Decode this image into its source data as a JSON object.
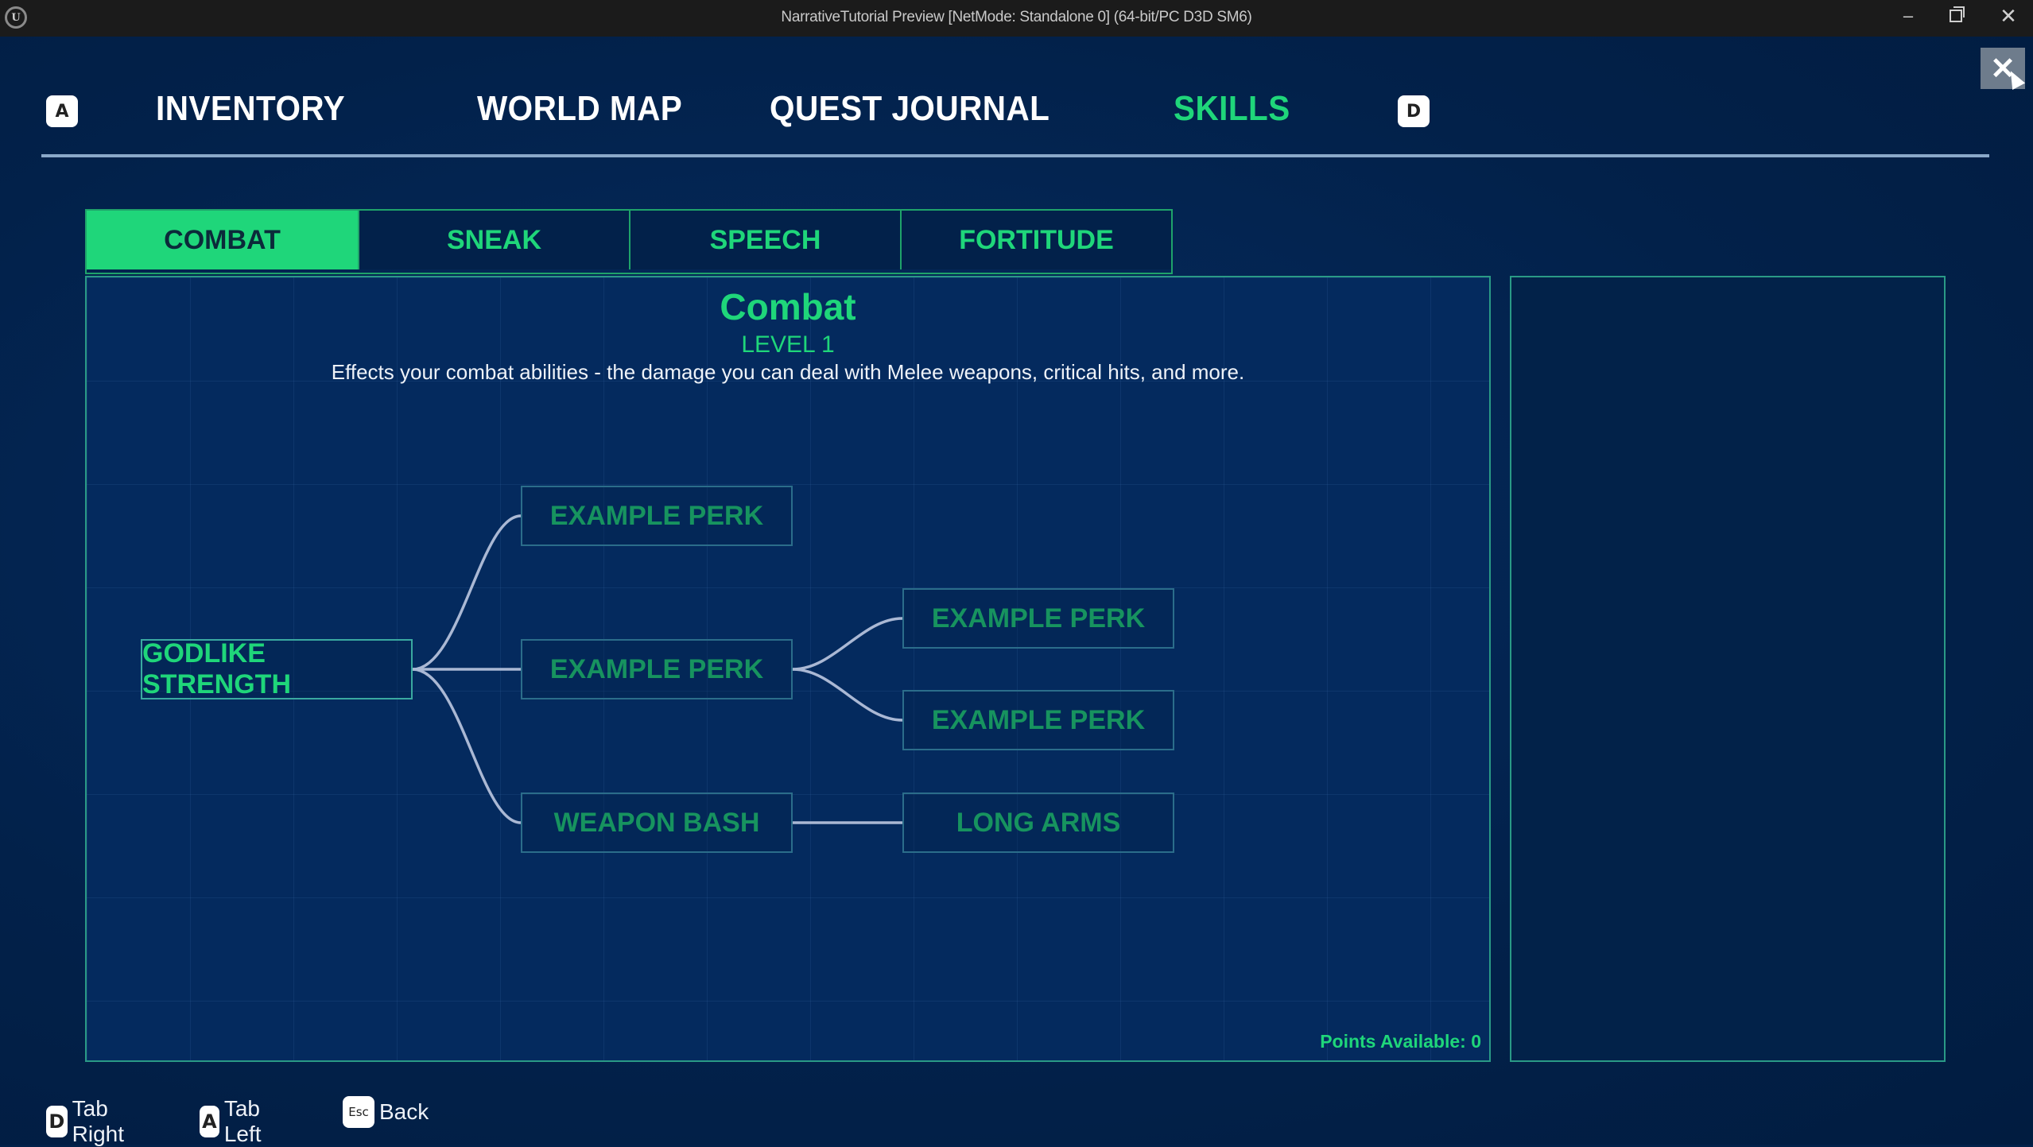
{
  "window": {
    "title": "NarrativeTutorial Preview [NetMode: Standalone 0]  (64-bit/PC D3D SM6)",
    "app_icon": "U",
    "minimize": "–",
    "close": "✕"
  },
  "top_nav": {
    "left_key": "A",
    "right_key": "D",
    "tabs": [
      {
        "label": "INVENTORY",
        "active": false
      },
      {
        "label": "WORLD MAP",
        "active": false
      },
      {
        "label": "QUEST JOURNAL",
        "active": false
      },
      {
        "label": "SKILLS",
        "active": true
      }
    ],
    "close_label": "✕"
  },
  "skill_tabs": [
    {
      "label": "COMBAT",
      "active": true
    },
    {
      "label": "SNEAK",
      "active": false
    },
    {
      "label": "SPEECH",
      "active": false
    },
    {
      "label": "FORTITUDE",
      "active": false
    }
  ],
  "skill_panel": {
    "title": "Combat",
    "level": "LEVEL 1",
    "description": "Effects your combat abilities - the damage you can deal with Melee weapons, critical hits, and more.",
    "points_available": "Points Available: 0"
  },
  "perk_tree": {
    "nodes": [
      {
        "id": "root",
        "label": "GODLIKE STRENGTH",
        "unlocked": true
      },
      {
        "id": "p1",
        "label": "EXAMPLE PERK",
        "unlocked": false
      },
      {
        "id": "p2",
        "label": "EXAMPLE PERK",
        "unlocked": false
      },
      {
        "id": "p3",
        "label": "WEAPON BASH",
        "unlocked": false
      },
      {
        "id": "p4",
        "label": "EXAMPLE PERK",
        "unlocked": false
      },
      {
        "id": "p5",
        "label": "EXAMPLE PERK",
        "unlocked": false
      },
      {
        "id": "p6",
        "label": "LONG ARMS",
        "unlocked": false
      }
    ],
    "edges": [
      [
        "root",
        "p1"
      ],
      [
        "root",
        "p2"
      ],
      [
        "root",
        "p3"
      ],
      [
        "p2",
        "p4"
      ],
      [
        "p2",
        "p5"
      ],
      [
        "p3",
        "p6"
      ]
    ]
  },
  "colors": {
    "accent_green": "#1fd67a",
    "locked_green": "#17935f",
    "background": "#02214a",
    "border_teal": "#2a9a86"
  },
  "footer": {
    "hints": [
      {
        "key": "D",
        "label": "Tab Right"
      },
      {
        "key": "A",
        "label": "Tab Left"
      },
      {
        "key": "Esc",
        "label": "Back"
      }
    ]
  }
}
